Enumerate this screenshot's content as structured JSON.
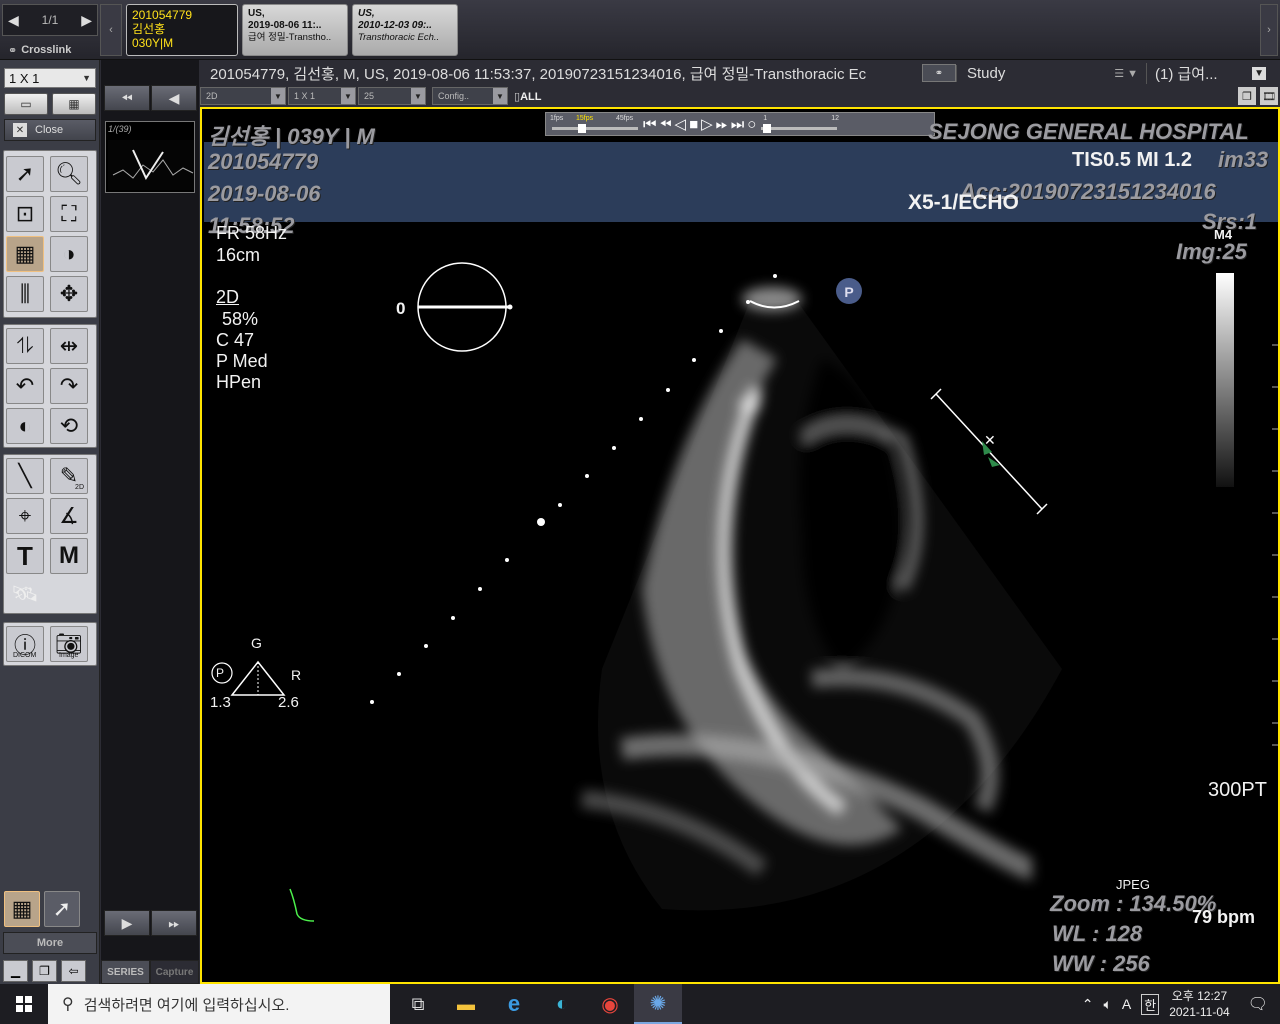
{
  "pagenav": {
    "label": "1/1",
    "prev": "◀",
    "next": "▶"
  },
  "crosslink": {
    "label": "Crosslink"
  },
  "study_tabs": [
    {
      "line1": "201054779",
      "line2": "김선홍",
      "line3": "030Y|M"
    },
    {
      "line1": "US,",
      "line2": "2019-08-06 11:..",
      "line3": "급여 정밀-Transtho.."
    },
    {
      "line1": "US,",
      "line2": "2010-12-03 09:..",
      "line3": "Transthoracic Ech.."
    }
  ],
  "layout": {
    "value": "1 X 1"
  },
  "close_label": "Close",
  "more_label": "More",
  "series_tabs": {
    "series": "SERIES",
    "capture": "Capture"
  },
  "thumb_label": "1/(39)",
  "tool_labels": {
    "dicom": "DICOM",
    "image": "Image",
    "twod": "2D",
    "text": "T",
    "marker": "M"
  },
  "inforow": {
    "info": "201054779, 김선홍, M, US, 2019-08-06 11:53:37, 20190723151234016, 급여 정밀-Transthoracic Ec",
    "study": "Study",
    "selection": "(1) 급여..."
  },
  "controls": {
    "mode": "2D",
    "layout": "1 X 1",
    "frames": "25",
    "config": "Config..",
    "all": "ALL"
  },
  "player": {
    "fps_min": "1fps",
    "fps_mid": "15fps",
    "fps_max": "45fps",
    "frame_start": "1",
    "frame_end": "12"
  },
  "overlay": {
    "patient": "김선홍 | 039Y | M",
    "id": "201054779",
    "date": "2019-08-06",
    "time": "11:58:52",
    "hospital": "SEJONG GENERAL HOSPITAL",
    "tis": "TIS0.5   MI 1.2",
    "im_no": "im33",
    "acc": "Acc:20190723151234016",
    "probe": "X5-1/ECHO",
    "srs": "Srs:1",
    "img": "Img:25",
    "m4": "M4",
    "fr": "FR 58Hz",
    "depth": "16cm",
    "mode": "2D",
    "gain": "58%",
    "c": "C 47",
    "p": "P Med",
    "hpen": "HPen",
    "angle": "0",
    "g": "G",
    "r": "R",
    "p_marker": "P",
    "left_val": "1.3",
    "right_val": "2.6",
    "pt": "300PT",
    "jpeg": "JPEG",
    "zoom": "Zoom : 134.50%",
    "bpm": "79 bpm",
    "wl": "WL : 128",
    "ww": "WW : 256"
  },
  "taskbar": {
    "search_placeholder": "검색하려면 여기에 입력하십시오.",
    "time": "오후 12:27",
    "date": "2021-11-04",
    "ime_a": "A",
    "ime_han": "한"
  }
}
